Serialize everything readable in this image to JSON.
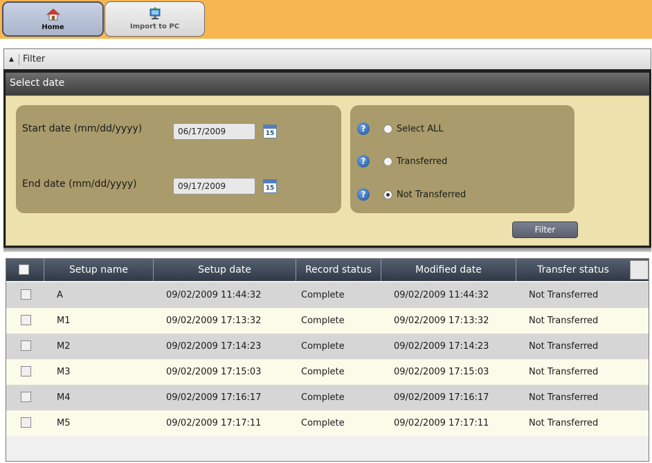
{
  "toolbar": {
    "home_label": "Home",
    "import_label": "Import to PC"
  },
  "filter_bar": {
    "label": "Filter",
    "toggle_icon": "triangle-up-icon"
  },
  "select_date": {
    "title": "Select date",
    "start_label": "Start date (mm/dd/yyyy)",
    "start_value": "06/17/2009",
    "end_label": "End date (mm/dd/yyyy)",
    "end_value": "09/17/2009",
    "calendar_day": "15",
    "help_glyph": "?",
    "options": [
      {
        "label": "Select ALL",
        "selected": false
      },
      {
        "label": "Transferred",
        "selected": false
      },
      {
        "label": "Not Transferred",
        "selected": true
      }
    ],
    "filter_button": "Filter"
  },
  "table": {
    "columns": [
      "Setup name",
      "Setup date",
      "Record status",
      "Modified date",
      "Transfer status"
    ],
    "rows": [
      {
        "name": "A",
        "setup_date": "09/02/2009 11:44:32",
        "record_status": "Complete",
        "modified_date": "09/02/2009 11:44:32",
        "transfer_status": "Not Transferred"
      },
      {
        "name": "M1",
        "setup_date": "09/02/2009 17:13:32",
        "record_status": "Complete",
        "modified_date": "09/02/2009 17:13:32",
        "transfer_status": "Not Transferred"
      },
      {
        "name": "M2",
        "setup_date": "09/02/2009 17:14:23",
        "record_status": "Complete",
        "modified_date": "09/02/2009 17:14:23",
        "transfer_status": "Not Transferred"
      },
      {
        "name": "M3",
        "setup_date": "09/02/2009 17:15:03",
        "record_status": "Complete",
        "modified_date": "09/02/2009 17:15:03",
        "transfer_status": "Not Transferred"
      },
      {
        "name": "M4",
        "setup_date": "09/02/2009 17:16:17",
        "record_status": "Complete",
        "modified_date": "09/02/2009 17:16:17",
        "transfer_status": "Not Transferred"
      },
      {
        "name": "M5",
        "setup_date": "09/02/2009 17:17:11",
        "record_status": "Complete",
        "modified_date": "09/02/2009 17:17:11",
        "transfer_status": "Not Transferred"
      }
    ]
  },
  "colors": {
    "toolbar_bg": "#f7b652",
    "panel_bg": "#ede2ad",
    "group_bg": "#a99b6b",
    "header_bg": "#303946"
  }
}
